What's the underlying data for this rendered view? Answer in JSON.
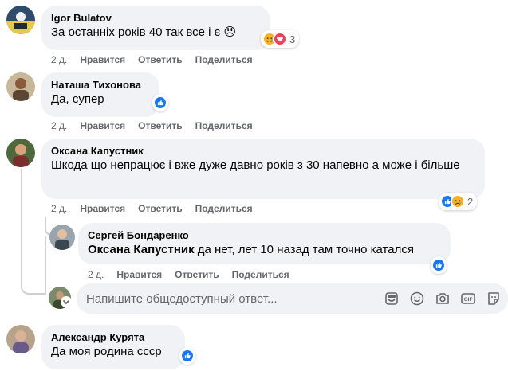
{
  "comments": [
    {
      "author": "Igor Bulatov",
      "text": "За останніх років 40 так все і є",
      "emoji": "😠",
      "reaction_count": "3",
      "time": "2 д.",
      "like": "Нравится",
      "reply": "Ответить",
      "share": "Поделиться"
    },
    {
      "author": "Наташа Тихонова",
      "text": "Да, супер",
      "time": "2 д.",
      "like": "Нравится",
      "reply": "Ответить",
      "share": "Поделиться"
    },
    {
      "author": "Оксана Капустник",
      "text": "Шкода що непрацює і вже дуже давно років з 30 напевно а може і більше",
      "reaction_count": "2",
      "time": "2 д.",
      "like": "Нравится",
      "reply": "Ответить",
      "share": "Поделиться"
    },
    {
      "author": "Сергей Бондаренко",
      "mention": "Оксана Капустник",
      "text": " да нет, лет 10 назад там точно катался",
      "time": "2 д.",
      "like": "Нравится",
      "reply": "Ответить",
      "share": "Поделиться"
    },
    {
      "author": "Александр Курята",
      "text": "Да моя родина ссср"
    }
  ],
  "reply_box": {
    "placeholder": "Напишите общедоступный ответ..."
  },
  "colors": {
    "like_blue": "#1877f2",
    "love_red": "#f33e58",
    "haha_yellow": "#f7b125",
    "bubble_bg": "#f0f2f5",
    "secondary_text": "#65676b"
  },
  "icons": [
    "like-icon",
    "love-icon",
    "sad-icon",
    "sticker-icon",
    "emoji-icon",
    "camera-icon",
    "gif-icon",
    "attach-sticker-icon",
    "chevron-down-icon"
  ]
}
